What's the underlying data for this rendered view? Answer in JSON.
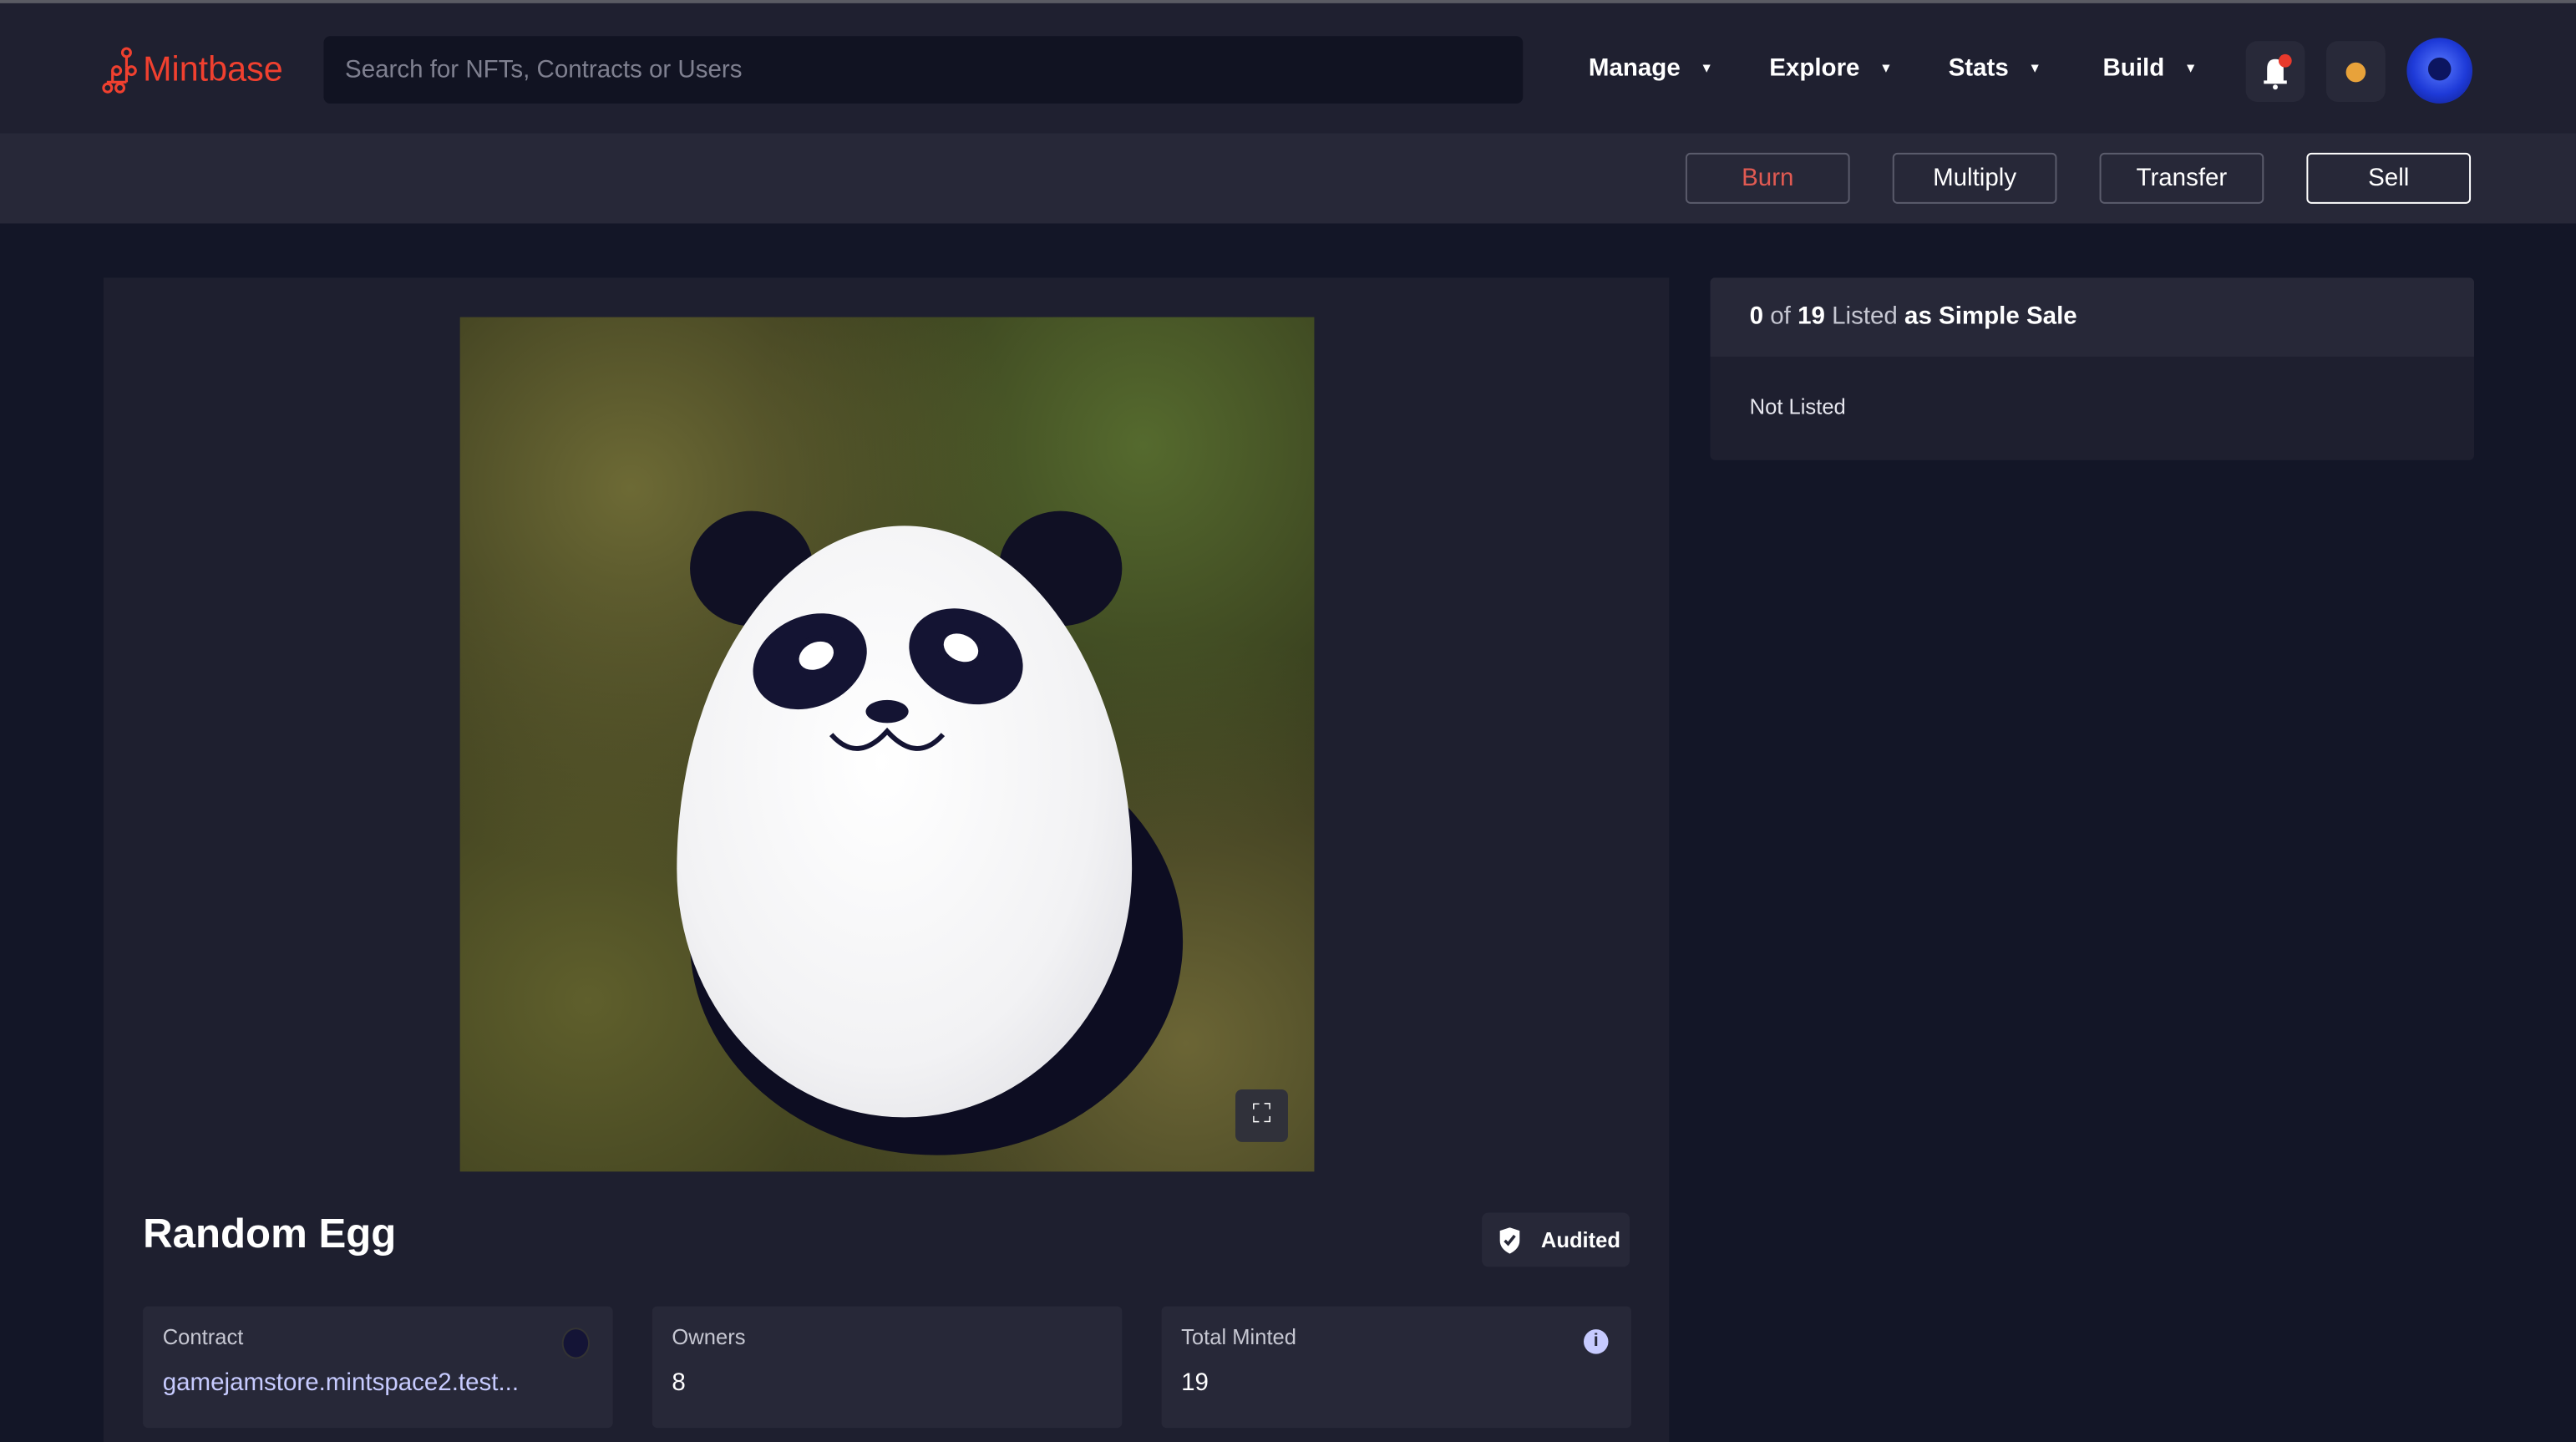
{
  "nav": {
    "brand": "Mintbase",
    "search_placeholder": "Search for NFTs, Contracts or Users",
    "menus": [
      "Manage",
      "Explore",
      "Stats",
      "Build"
    ]
  },
  "actions": {
    "burn": "Burn",
    "multiply": "Multiply",
    "transfer": "Transfer",
    "sell": "Sell"
  },
  "nft": {
    "title": "Random Egg",
    "badge": "Audited",
    "stats": [
      {
        "label": "Contract",
        "value": "gamejamstore.mintspace2.test..."
      },
      {
        "label": "Owners",
        "value": "8"
      },
      {
        "label": "Total Minted",
        "value": "19"
      }
    ]
  },
  "listing": {
    "listed": "0",
    "of": "of",
    "total": "19",
    "listed_label": "Listed",
    "as": "as Simple Sale",
    "status": "Not Listed"
  },
  "colors": {
    "brand": "#f0402f",
    "burn": "#e05a52",
    "notification": "#e8392c",
    "wallet": "#e8a23a",
    "link": "#c7cbff"
  }
}
